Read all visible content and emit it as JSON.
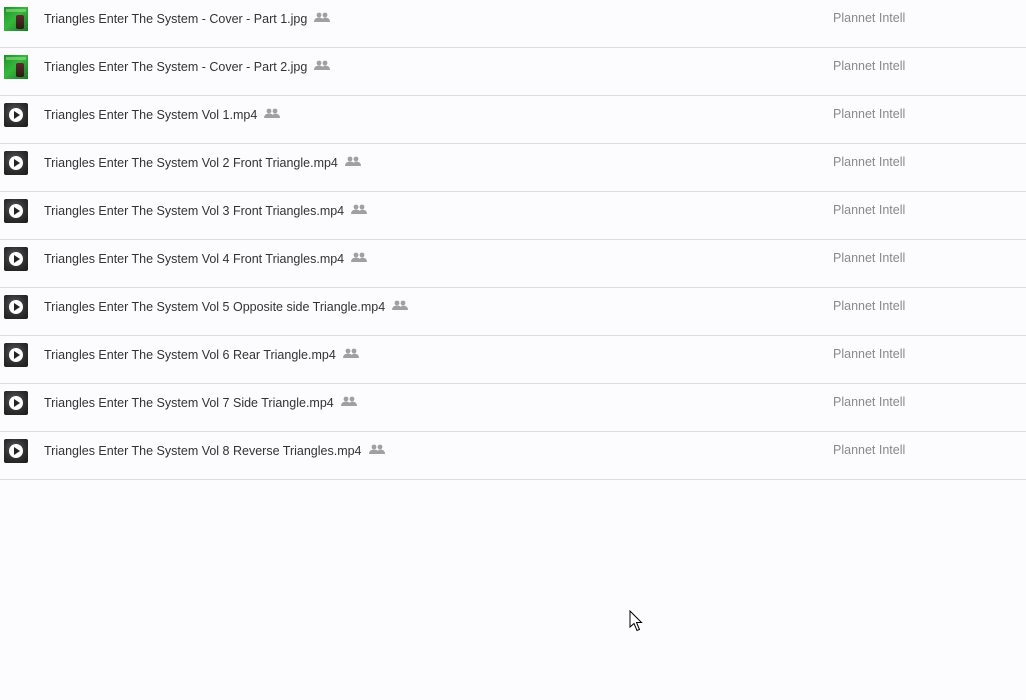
{
  "files": [
    {
      "name": "Triangles Enter The System - Cover - Part 1.jpg",
      "type": "image",
      "owner": "Plannet Intell",
      "shared_icon": "people-icon"
    },
    {
      "name": "Triangles Enter The System - Cover - Part 2.jpg",
      "type": "image",
      "owner": "Plannet Intell",
      "shared_icon": "people-icon"
    },
    {
      "name": "Triangles Enter The System Vol 1.mp4",
      "type": "video",
      "owner": "Plannet Intell",
      "shared_icon": "people-icon"
    },
    {
      "name": "Triangles Enter The System Vol 2 Front Triangle.mp4",
      "type": "video",
      "owner": "Plannet Intell",
      "shared_icon": "people-icon"
    },
    {
      "name": "Triangles Enter The System Vol 3 Front Triangles.mp4",
      "type": "video",
      "owner": "Plannet Intell",
      "shared_icon": "people-icon"
    },
    {
      "name": "Triangles Enter The System Vol 4 Front Triangles.mp4",
      "type": "video",
      "owner": "Plannet Intell",
      "shared_icon": "people-icon"
    },
    {
      "name": "Triangles Enter The System Vol 5 Opposite side Triangle.mp4",
      "type": "video",
      "owner": "Plannet Intell",
      "shared_icon": "people-icon"
    },
    {
      "name": "Triangles Enter The System Vol 6 Rear Triangle.mp4",
      "type": "video",
      "owner": "Plannet Intell",
      "shared_icon": "people-icon"
    },
    {
      "name": "Triangles Enter The System Vol 7 Side Triangle.mp4",
      "type": "video",
      "owner": "Plannet Intell",
      "shared_icon": "people-icon"
    },
    {
      "name": "Triangles Enter The System Vol 8 Reverse Triangles.mp4",
      "type": "video",
      "owner": "Plannet Intell",
      "shared_icon": "people-icon"
    }
  ],
  "colors": {
    "background": "#fcfbfe",
    "file_name_text": "#333333",
    "owner_text": "#8a8a8a",
    "divider": "#dcdcdc",
    "shared_icon": "#a0a0a0"
  }
}
